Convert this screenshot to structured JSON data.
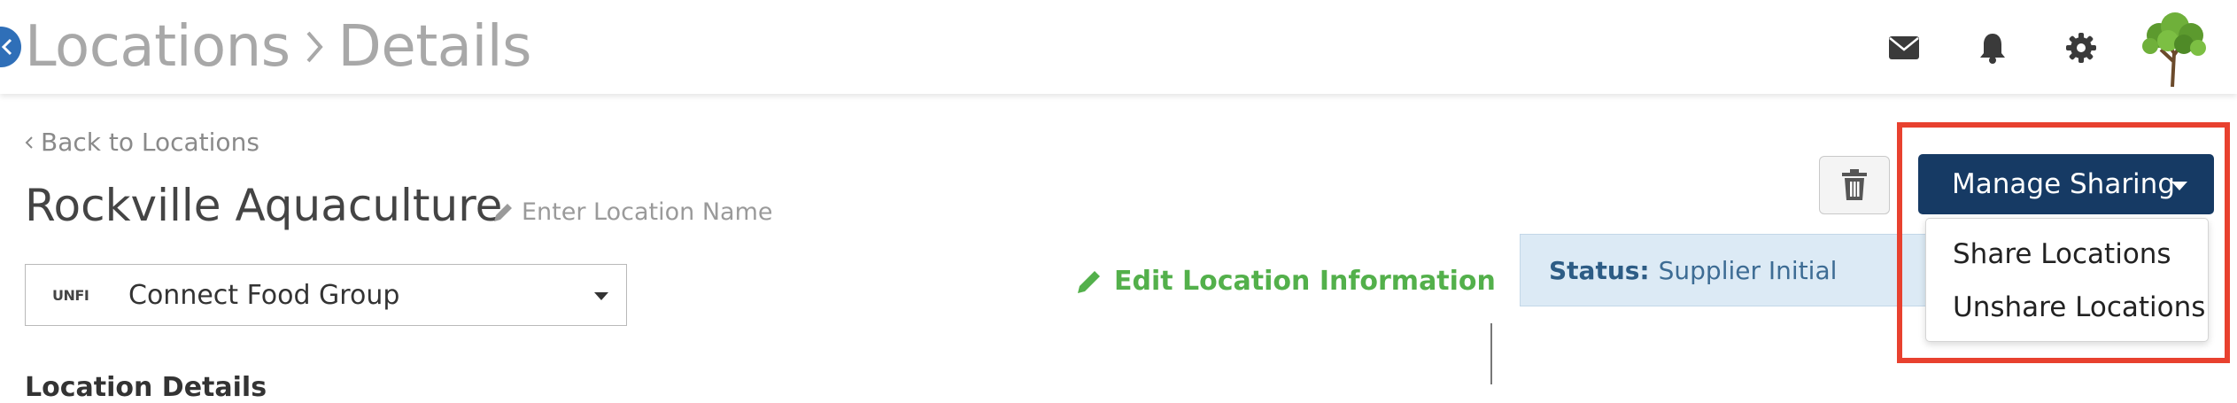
{
  "header": {
    "breadcrumb": [
      "Locations",
      "Details"
    ],
    "icons": [
      "back-chevron-icon",
      "envelope-icon",
      "bell-icon",
      "gear-icon",
      "avatar-tree-icon"
    ]
  },
  "location": {
    "back_label": "Back to Locations",
    "name": "Rockville Aquaculture",
    "name_placeholder": "Enter Location Name",
    "org": {
      "logo_text": "UNFI",
      "selected": "Connect Food Group"
    },
    "edit_info_label": "Edit Location Information",
    "section_heading_partial": "Location Details"
  },
  "status": {
    "label": "Status:",
    "value": "Supplier Initial"
  },
  "sharing": {
    "button_label": "Manage Sharing",
    "menu": [
      "Share Locations",
      "Unshare Locations"
    ]
  },
  "colors": {
    "primary_button": "#163a64",
    "edit_green": "#53b04b",
    "status_bg": "#dceaf5",
    "highlight_red": "#e8412f",
    "back_circle": "#2f6fb8"
  }
}
